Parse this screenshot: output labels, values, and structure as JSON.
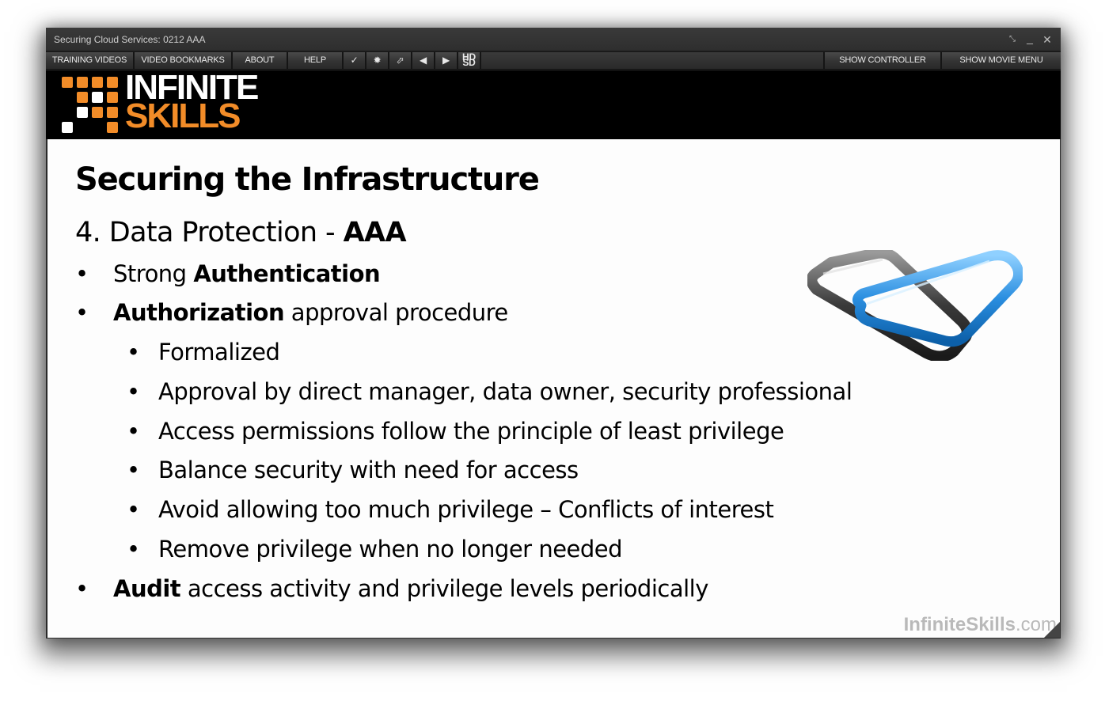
{
  "window": {
    "title": "Securing Cloud Services: 0212 AAA",
    "controls": {
      "resize_glyph": "⤡",
      "minimize_glyph": "_",
      "close_glyph": "✕"
    }
  },
  "menubar": {
    "items": [
      {
        "label": "TRAINING VIDEOS"
      },
      {
        "label": "VIDEO BOOKMARKS"
      },
      {
        "label": "ABOUT"
      },
      {
        "label": "HELP"
      }
    ],
    "icons": {
      "check": "✓",
      "settings": "✹",
      "popout": "⬀",
      "prev": "◀",
      "next": "▶",
      "quality_top": "HD",
      "quality_bottom": "SD"
    },
    "right_items": [
      {
        "label": "SHOW CONTROLLER"
      },
      {
        "label": "SHOW MOVIE MENU"
      }
    ]
  },
  "brand": {
    "line1": "INFINITE",
    "line2": "SKILLS",
    "accent_color": "#f28c28"
  },
  "slide": {
    "title": "Securing the Infrastructure",
    "subtitle_plain": "4. Data Protection - ",
    "subtitle_bold": "AAA",
    "bullet_char": "•",
    "bullets": [
      {
        "plain_before": "Strong ",
        "bold": "Authentication",
        "plain_after": ""
      },
      {
        "plain_before": "",
        "bold": "Authorization",
        "plain_after": " approval procedure"
      },
      {
        "text": "Formalized"
      },
      {
        "text": "Approval by direct manager, data owner, security professional"
      },
      {
        "text": "Access permissions follow the principle of least privilege"
      },
      {
        "text": "Balance security with need for access"
      },
      {
        "text": "Avoid allowing too much privilege – Conflicts of interest"
      },
      {
        "text": "Remove privilege when no longer needed"
      },
      {
        "plain_before": "",
        "bold": "Audit",
        "plain_after": " access activity and privilege levels periodically"
      }
    ],
    "image": "chain-links-icon"
  },
  "watermark": {
    "bold": "InfiniteSkills",
    "plain": ".com"
  }
}
